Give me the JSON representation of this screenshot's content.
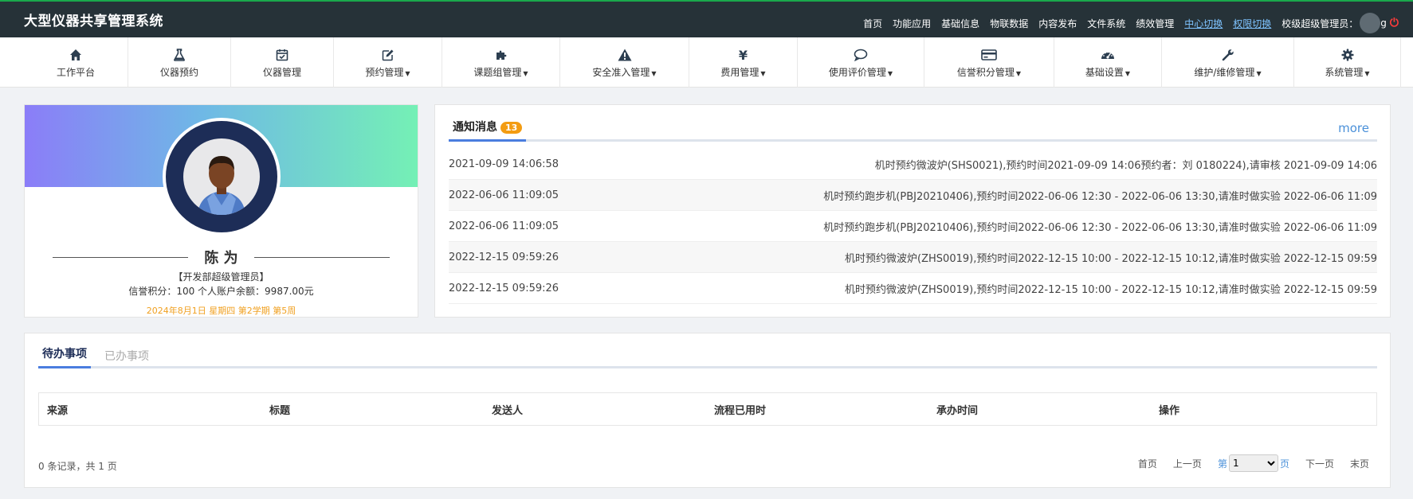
{
  "header": {
    "title": "大型仪器共享管理系统",
    "nav": [
      {
        "label": "首页",
        "link": false
      },
      {
        "label": "功能应用",
        "link": false
      },
      {
        "label": "基础信息",
        "link": false
      },
      {
        "label": "物联数据",
        "link": false
      },
      {
        "label": "内容发布",
        "link": false
      },
      {
        "label": "文件系统",
        "link": false
      },
      {
        "label": "绩效管理",
        "link": false
      },
      {
        "label": "中心切换",
        "link": true
      },
      {
        "label": "权限切换",
        "link": true
      }
    ],
    "user_label": "校级超级管理员：",
    "user_suffix": "g"
  },
  "menu": [
    {
      "label": "工作平台",
      "icon": "home-icon",
      "dropdown": false
    },
    {
      "label": "仪器预约",
      "icon": "flask-icon",
      "dropdown": false
    },
    {
      "label": "仪器管理",
      "icon": "calendar-check-icon",
      "dropdown": false
    },
    {
      "label": "预约管理",
      "icon": "edit-icon",
      "dropdown": true
    },
    {
      "label": "课题组管理",
      "icon": "puzzle-icon",
      "dropdown": true
    },
    {
      "label": "安全准入管理",
      "icon": "warning-icon",
      "dropdown": true
    },
    {
      "label": "费用管理",
      "icon": "yen-icon",
      "dropdown": true
    },
    {
      "label": "使用评价管理",
      "icon": "comment-icon",
      "dropdown": true
    },
    {
      "label": "信誉积分管理",
      "icon": "credit-card-icon",
      "dropdown": true
    },
    {
      "label": "基础设置",
      "icon": "dashboard-icon",
      "dropdown": true
    },
    {
      "label": "维护/维修管理",
      "icon": "wrench-icon",
      "dropdown": true
    },
    {
      "label": "系统管理",
      "icon": "cog-icon",
      "dropdown": true
    }
  ],
  "profile": {
    "name": "陈  为",
    "role": "【开发部超级管理员】",
    "credit": "信誉积分：100 个人账户余额：9987.00元",
    "date": "2024年8月1日 星期四 第2学期 第5周"
  },
  "notices": {
    "title": "通知消息",
    "count": "13",
    "more": "more",
    "rows": [
      {
        "time": "2021-09-09 14:06:58",
        "message": "机时预约微波炉(SHS0021),预约时间2021-09-09 14:06预约者：刘      0180224),请审核 2021-09-09 14:06"
      },
      {
        "time": "2022-06-06 11:09:05",
        "message": "机时预约跑步机(PBJ20210406),预约时间2022-06-06 12:30 - 2022-06-06 13:30,请准时做实验 2022-06-06 11:09"
      },
      {
        "time": "2022-06-06 11:09:05",
        "message": "机时预约跑步机(PBJ20210406),预约时间2022-06-06 12:30 - 2022-06-06 13:30,请准时做实验 2022-06-06 11:09"
      },
      {
        "time": "2022-12-15 09:59:26",
        "message": "机时预约微波炉(ZHS0019),预约时间2022-12-15 10:00 - 2022-12-15 10:12,请准时做实验 2022-12-15 09:59"
      },
      {
        "time": "2022-12-15 09:59:26",
        "message": "机时预约微波炉(ZHS0019),预约时间2022-12-15 10:00 - 2022-12-15 10:12,请准时做实验 2022-12-15 09:59"
      }
    ]
  },
  "todo": {
    "tab_active": "待办事项",
    "tab_inactive": "已办事项",
    "columns": [
      "来源",
      "标题",
      "发送人",
      "流程已用时",
      "承办时间",
      "操作"
    ],
    "records": "0 条记录，共 1 页",
    "pager": {
      "first": "首页",
      "prev": "上一页",
      "page_prefix": "第",
      "page_value": "1",
      "page_suffix": "页",
      "next": "下一页",
      "last": "末页"
    }
  },
  "colors": {
    "topbar": "#263238",
    "accent": "#4a7ddf",
    "badge": "#f39c12",
    "date": "#f0a020",
    "link": "#7ec3ff"
  }
}
